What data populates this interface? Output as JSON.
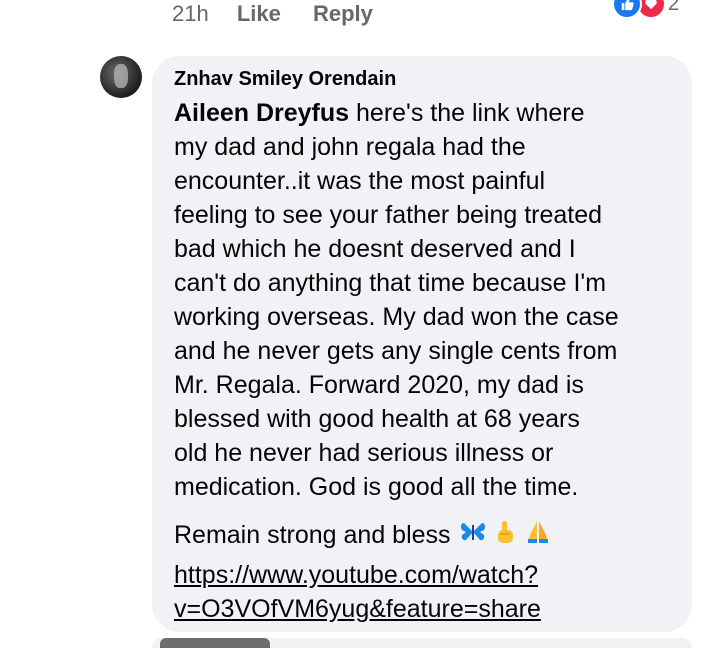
{
  "comment_meta": {
    "time": "21h",
    "like_label": "Like",
    "reply_label": "Reply",
    "reaction_count": "2"
  },
  "comment": {
    "author": "Znhav Smiley Orendain",
    "mention": "Aileen Dreyfus",
    "lines": [
      " here's the link where",
      "my dad and john regala had the",
      "encounter..it was the most painful",
      "feeling to see your father being treated",
      "bad which he doesnt deserved and I",
      "can't do anything that time because I'm",
      "working overseas. My dad won the case",
      "and he never gets any single cents from",
      "Mr. Regala. Forward 2020, my dad is",
      "blessed with good health at 68 years",
      "old he never had serious illness or",
      "medication. God is good all the time."
    ],
    "closing": "Remain strong and bless",
    "link_line1": "https://www.youtube.com/watch?",
    "link_line2": "v=O3VOfVM6yug&feature=share"
  },
  "icons": {
    "like": "thumbs-up-icon",
    "love": "heart-icon",
    "emojis": [
      "butterfly-emoji",
      "index-pointing-up-emoji",
      "folded-hands-emoji"
    ]
  },
  "colors": {
    "bubble_bg": "#f0f2f5",
    "meta_text": "#65676b",
    "like_blue": "#1877f2",
    "love_red": "#f02849"
  }
}
